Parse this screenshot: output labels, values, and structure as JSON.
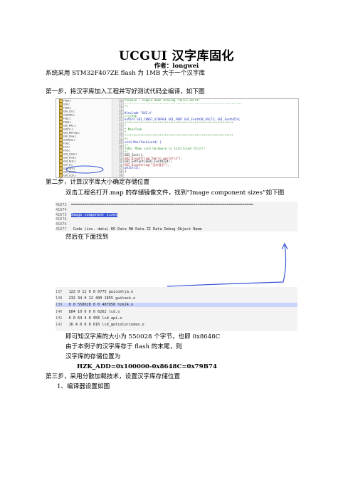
{
  "title": "UCGUI 汉字库固化",
  "author": "作者：longwei",
  "intro": "系统采用 STM32F407ZE flash 为 1MB 大于一个汉字库",
  "step1": "第一步，将汉字库加入工程并写好测试代码全编译，如下图",
  "ide": {
    "tree_items": [
      "FileA.c",
      "GUI.c",
      "FileB.c",
      "GUI_ctrl.c",
      "GUIDRV.c",
      "FileC.c",
      "FileD.c",
      "GUI_ARC.c",
      "GUICC.c",
      "GUI_Bitmap.c",
      "GUI_Char.c",
      "GUIAlloc.c",
      "F16.c",
      "F12.c",
      "F24.c",
      "GUI_Color.c",
      "GUI_Font.c",
      "GUI_Text.c",
      "GUI_X.c",
      "GUIConf.c",
      "GUI_DISP.c",
      "GUI_LCD.c",
      "GUI_MEM.c",
      "GUI_Ctrl.c",
      "GUI_JPG.c",
      "GUI_BMP.c",
      "LCDConf.c",
      "LCD_api.c",
      "main.c",
      "hzk24.c",
      "GUI_Core.c",
      "GUIFonts.c",
      "GUIDemo.c",
      "GUIWin.c",
      "GUIWidget.c",
      "GUI_Task.c",
      "Misc"
    ],
    "line_numbers": [
      "16",
      "17",
      "18",
      "19",
      "20",
      "21",
      "22",
      "23",
      "24",
      "25",
      "26",
      "27",
      "28",
      "29",
      "30",
      "31",
      "32",
      "33",
      "34",
      "35",
      "36",
      "37",
      "38",
      "39"
    ],
    "code": [
      {
        "t": "Purpose     : Simple demo drawing \"Hello world\"",
        "c": "c-comment"
      },
      {
        "t": "-------------------------------------------------------------------",
        "c": "c-comment"
      },
      {
        "t": "*/",
        "c": "c-comment"
      },
      {
        "t": "",
        "c": "c-plain"
      },
      {
        "t": "#include \"GUI.h\"",
        "c": "c-kw"
      },
      {
        "t": "//汉字库",
        "c": "c-comment"
      },
      {
        "t": "extern GUI_CONST_STORAGE GUI_FONT GUI_FontHZK_ASCII;      GUI_FontHZ24;",
        "c": "c-kw"
      },
      {
        "t": "/*************************************************************",
        "c": "c-comment"
      },
      {
        "t": "*",
        "c": "c-comment"
      },
      {
        "t": "*                 MainTask",
        "c": "c-comment"
      },
      {
        "t": "*",
        "c": "c-comment"
      },
      {
        "t": "**************************************************************",
        "c": "c-comment"
      },
      {
        "t": "*/",
        "c": "c-comment"
      },
      {
        "t": "void MainTask(void) {",
        "c": "c-kw"
      },
      {
        "t": "/*",
        "c": "c-comment"
      },
      {
        "t": "  ToDo:  Make sure hardware is initilized first!!",
        "c": "c-comment"
      },
      {
        "t": "*/",
        "c": "c-comment"
      },
      {
        "t": "  GUI_Init();",
        "c": "c-plain"
      },
      {
        "t": "  GUI_DispString(\"Hello world!\\n\");",
        "c": "c-str"
      },
      {
        "t": "  GUI_SetFont(&GUI_FontHZ24);",
        "c": "c-plain"
      },
      {
        "t": "  GUI_DispString(\"汉字显示\");",
        "c": "c-str"
      },
      {
        "t": "  while(1);",
        "c": "c-kw"
      },
      {
        "t": "}",
        "c": "c-plain"
      },
      {
        "t": "",
        "c": "c-plain"
      }
    ]
  },
  "step2": "第二步，计算汉字库大小确定存储位置",
  "step2_desc": "双击工程名打开.map 的存储镜像文件，找到“Image component sizes”如下图",
  "map1": {
    "rows": [
      {
        "n": "41673",
        "t": "=================================================================================="
      },
      {
        "n": "41674",
        "t": ""
      },
      {
        "n": "41675",
        "t": "Image component sizes",
        "hl": true
      },
      {
        "n": "41676",
        "t": ""
      },
      {
        "n": "41676",
        "t": ""
      },
      {
        "n": "41677",
        "t": "      Code (inc. data)   RO Data    RW Data    ZI Data      Debug   Object Name"
      }
    ]
  },
  "then_find": "然后在下面找到",
  "map2": {
    "rows": [
      {
        "n": "137",
        "t": "      122          0         12          0          0       6775   guicontja.o"
      },
      {
        "n": "138",
        "t": "      232         34          0         12        400       1855   guitask.o"
      },
      {
        "n": "139",
        "t": "        0          0     550028          0          0     407858   hzk24.o",
        "sel": true
      },
      {
        "n": "140",
        "t": "      884         10          0          0          0       6262   lcd.o"
      },
      {
        "n": "141",
        "t": "        0          0         64          4          0        956   lcd_api.o"
      },
      {
        "n": "142",
        "t": "       16          4          0          0          0        616   lcd_getcolorindex.o"
      }
    ]
  },
  "size_note": "即可知汉字库的大小为 550028 个字节，也即 0x8648C",
  "storage_note": "由于本例子的汉字库存于 flash 的末尾，则",
  "storage_pos": "汉字库的存储位置为",
  "formula": "HZK_ADD=0x100000-0x8648C=0x79B74",
  "step3": "第三步，采用分散加载技术，设置汉字库存储位置",
  "step3_sub": "1、编译器设置如图",
  "colors": {
    "annotation": "#3a56d6",
    "comment": "#2f8f2f",
    "keyword": "#1b2fb5"
  }
}
